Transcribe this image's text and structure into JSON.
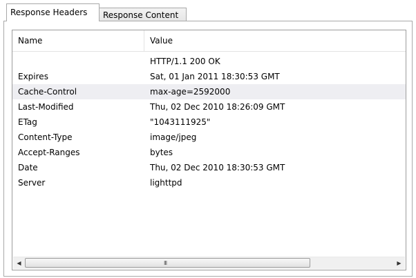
{
  "tabs": [
    {
      "label": "Response Headers",
      "active": true
    },
    {
      "label": "Response Content",
      "active": false
    }
  ],
  "columns": {
    "name": "Name",
    "value": "Value"
  },
  "rows": [
    {
      "name": "",
      "value": "HTTP/1.1 200 OK"
    },
    {
      "name": "Expires",
      "value": "Sat, 01 Jan 2011 18:30:53 GMT"
    },
    {
      "name": "Cache-Control",
      "value": "max-age=2592000"
    },
    {
      "name": "Last-Modified",
      "value": "Thu, 02 Dec 2010 18:26:09 GMT"
    },
    {
      "name": "ETag",
      "value": "\"1043111925\""
    },
    {
      "name": "Content-Type",
      "value": "image/jpeg"
    },
    {
      "name": "Accept-Ranges",
      "value": "bytes"
    },
    {
      "name": "Date",
      "value": "Thu, 02 Dec 2010 18:30:53 GMT"
    },
    {
      "name": "Server",
      "value": "lighttpd"
    }
  ],
  "selected_row": "Cache-Control",
  "scrollbar": {
    "grip": "III"
  },
  "colors": {
    "selection": "#eeeef2",
    "border": "#a8a8a8"
  }
}
